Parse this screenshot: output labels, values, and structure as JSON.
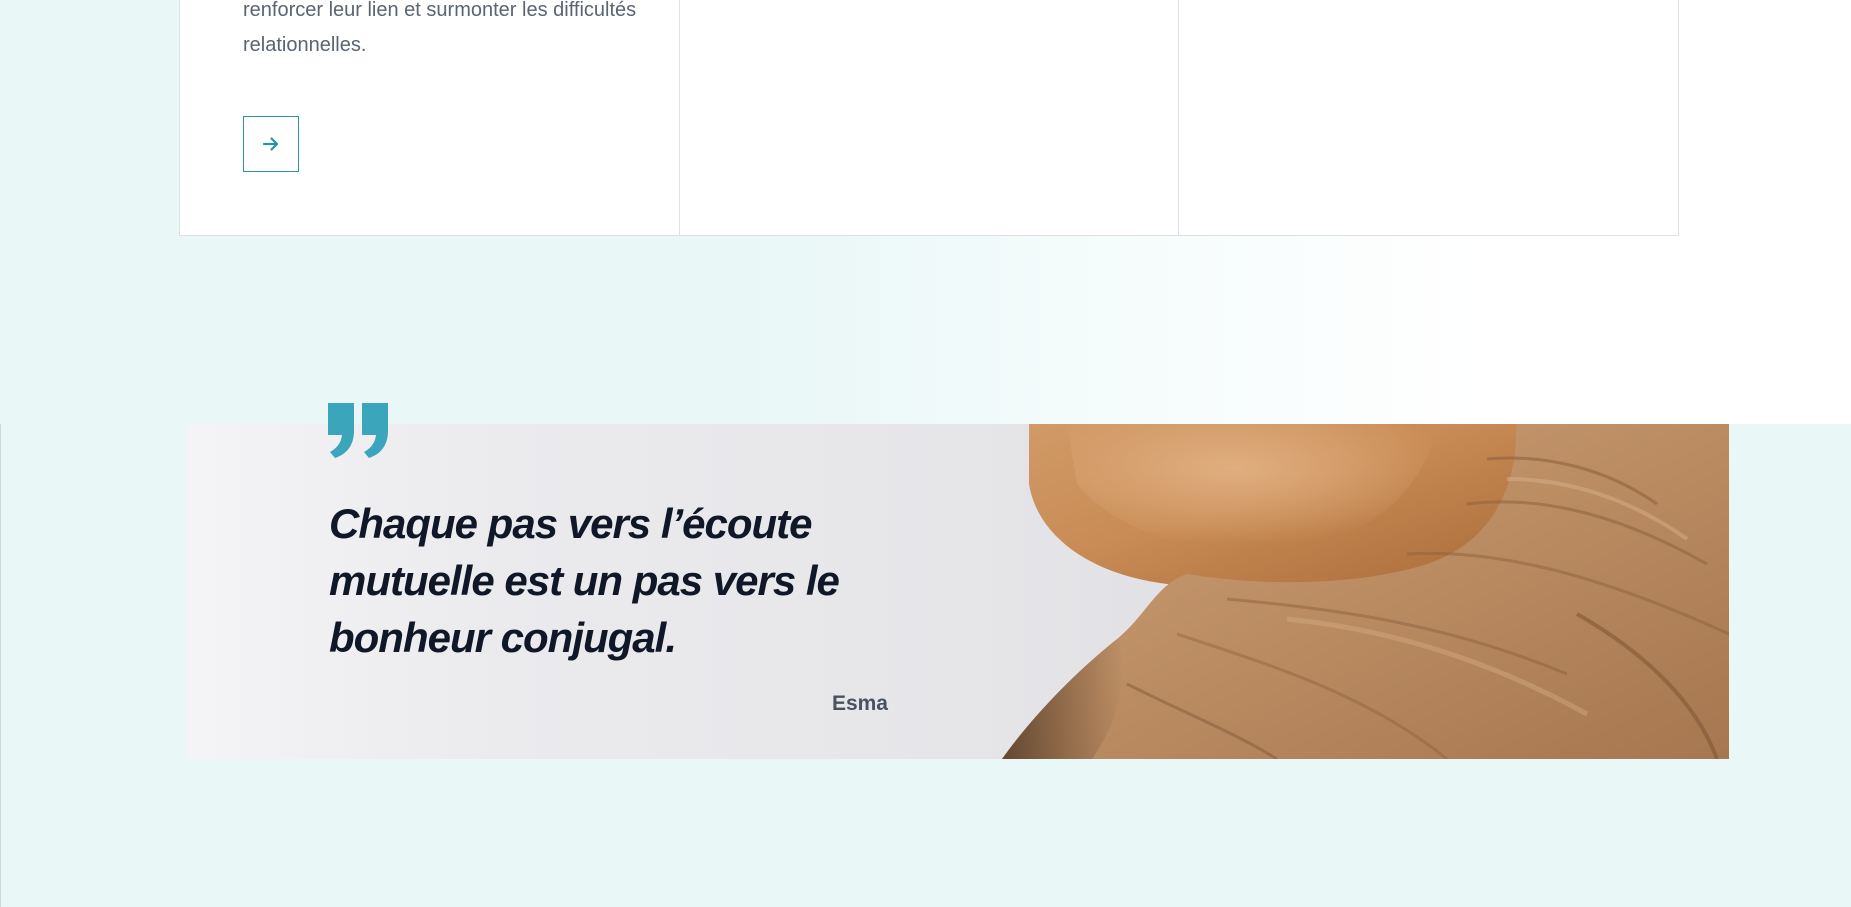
{
  "services": {
    "cards": [
      {
        "description": "renforcer leur lien et surmonter les difficultés relationnelles."
      },
      {
        "description": ""
      },
      {
        "description": ""
      }
    ]
  },
  "icons": {
    "card_button": "arrow-right-icon",
    "quote": "quote-icon"
  },
  "testimonial": {
    "quote": "Chaque pas vers l’écoute mutuelle est un pas vers le bonheur conjugal.",
    "author": "Esma"
  },
  "colors": {
    "accent": "#2b93a8",
    "quote_icon": "#3aa5bb",
    "quote_text": "#101828",
    "page_background": "#e9f7f7"
  }
}
